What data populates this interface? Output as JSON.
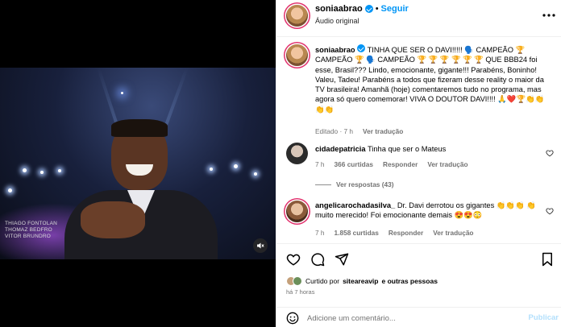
{
  "video": {
    "credits": [
      "THIAGO FONTOLAN",
      "THOMAZ BEDFRO",
      "VITOR BRUNDRO"
    ],
    "sound_icon": "speaker-muted-icon"
  },
  "header": {
    "username": "soniaabrao",
    "separator": "•",
    "follow_label": "Seguir",
    "audio_label": "Áudio original",
    "more_icon": "more-horizontal-icon"
  },
  "caption": {
    "username": "soniaabrao",
    "text": "TINHA QUE SER O DAVI!!!!! 🗣️ CAMPEÃO 🏆 CAMPEÃO 🏆 🗣️ CAMPEÃO 🏆 🏆 🏆 🏆 🏆 🏆 QUE BBB24 foi esse, Brasil??? Lindo, emocionante, gigante!!! Parabéns, Boninho! Valeu, Tadeu! Parabéns a todos que fizeram desse reality o maior da TV brasileira! Amanhã (hoje) comentaremos tudo no programa, mas agora só quero comemorar! VIVA O DOUTOR DAVI!!!! 🙏❤️🏆👏👏👏👏",
    "edited": "Editado · 7 h",
    "see_translation": "Ver tradução"
  },
  "comments": [
    {
      "username": "cidadepatricia",
      "text": "Tinha que ser o Mateus",
      "time": "7 h",
      "likes": "366 curtidas",
      "reply": "Responder",
      "see_translation": "Ver tradução",
      "view_replies": "Ver respostas (43)"
    },
    {
      "username": "angelicarochadasilva_",
      "text": "Dr. Davi derrotou os gigantes 👏👏👏 👏 muito merecido! Foi emocionante demais 😍😍😳",
      "time": "7 h",
      "likes": "1.858 curtidas",
      "reply": "Responder",
      "see_translation": "Ver tradução"
    }
  ],
  "actions": {
    "liked_by_prefix": "Curtido por",
    "liked_by_user": "siteareavip",
    "liked_by_suffix": "e outras pessoas",
    "time_ago": "há 7 horas"
  },
  "add_comment": {
    "placeholder": "Adicione um comentário...",
    "publish_label": "Publicar"
  },
  "colors": {
    "accent": "#0095f6",
    "muted": "#737373",
    "story_ring": "#e1306c"
  }
}
